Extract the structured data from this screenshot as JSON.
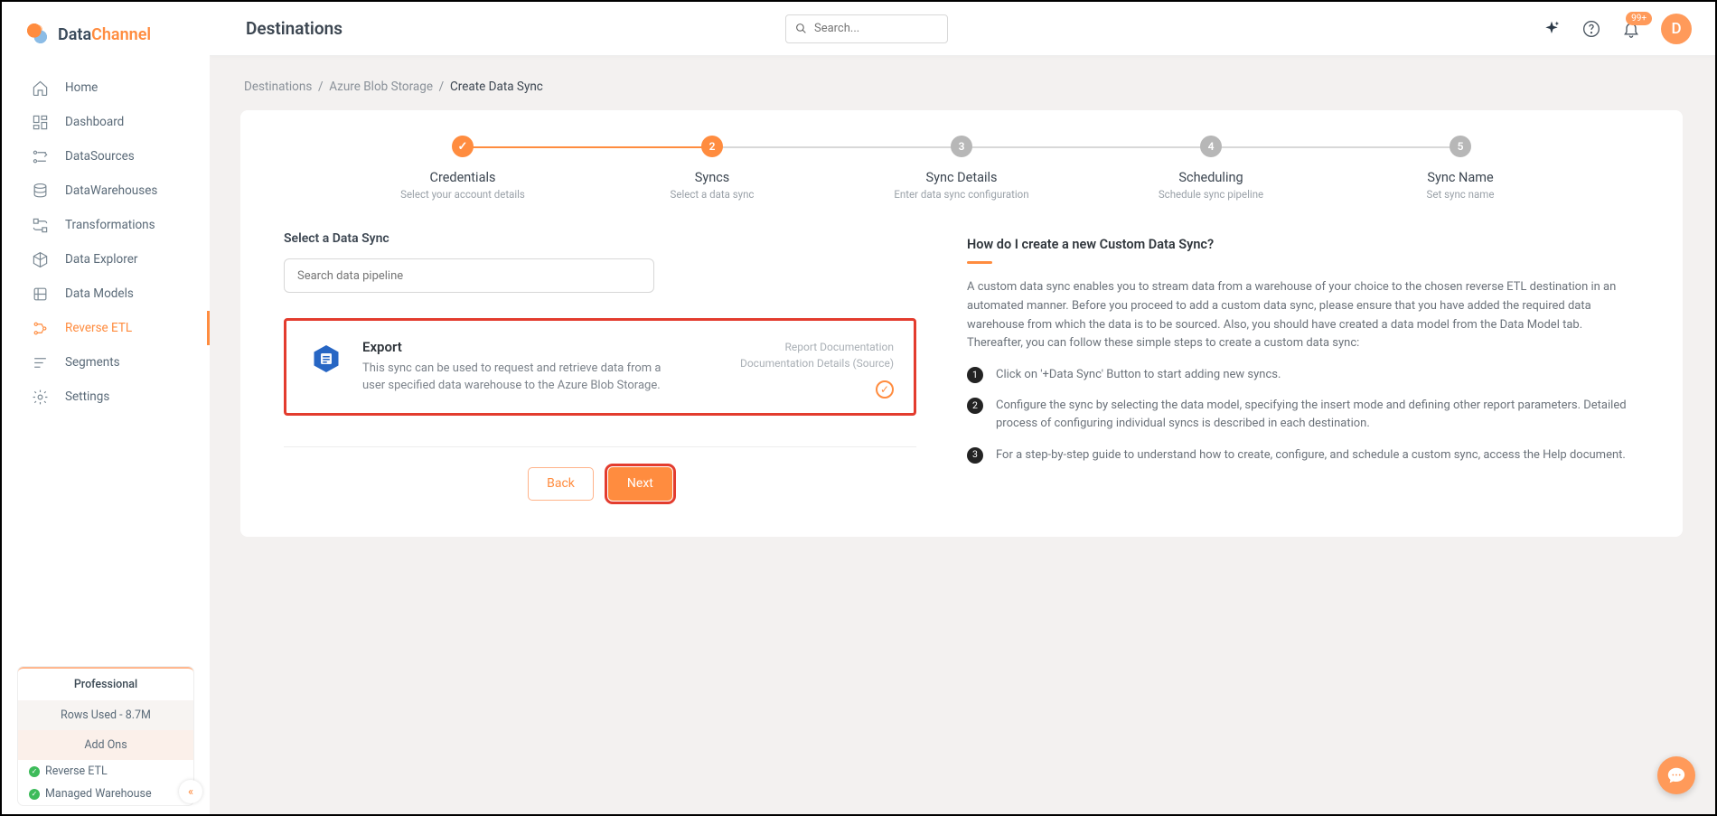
{
  "brand": {
    "name_part1": "Data",
    "name_part2": "Channel"
  },
  "sidebar": {
    "items": [
      {
        "label": "Home"
      },
      {
        "label": "Dashboard"
      },
      {
        "label": "DataSources"
      },
      {
        "label": "DataWarehouses"
      },
      {
        "label": "Transformations"
      },
      {
        "label": "Data Explorer"
      },
      {
        "label": "Data Models"
      },
      {
        "label": "Reverse ETL"
      },
      {
        "label": "Segments"
      },
      {
        "label": "Settings"
      }
    ],
    "plan": {
      "name": "Professional",
      "rows": "Rows Used - 8.7M",
      "addons_title": "Add Ons",
      "addons": [
        "Reverse ETL",
        "Managed Warehouse"
      ]
    }
  },
  "header": {
    "title": "Destinations",
    "search_placeholder": "Search...",
    "notif": "99+",
    "avatar": "D"
  },
  "breadcrumb": {
    "part1": "Destinations",
    "part2": "Azure Blob Storage",
    "part3": "Create Data Sync"
  },
  "steps": [
    {
      "num": "1",
      "title": "Credentials",
      "sub": "Select your account details",
      "state": "done"
    },
    {
      "num": "2",
      "title": "Syncs",
      "sub": "Select a data sync",
      "state": "active"
    },
    {
      "num": "3",
      "title": "Sync Details",
      "sub": "Enter data sync configuration",
      "state": "pending"
    },
    {
      "num": "4",
      "title": "Scheduling",
      "sub": "Schedule sync pipeline",
      "state": "pending"
    },
    {
      "num": "5",
      "title": "Sync Name",
      "sub": "Set sync name",
      "state": "pending"
    }
  ],
  "syncs": {
    "section_label": "Select a Data Sync",
    "search_placeholder": "Search data pipeline",
    "card": {
      "title": "Export",
      "desc": "This sync can be used to request and retrieve data from a user specified data warehouse to the Azure Blob Storage.",
      "meta1": "Report Documentation",
      "meta2": "Documentation Details (Source)"
    }
  },
  "buttons": {
    "back": "Back",
    "next": "Next"
  },
  "help": {
    "title": "How do I create a new Custom Data Sync?",
    "p": "A custom data sync enables you to stream data from a warehouse of your choice to the chosen reverse ETL destination in an automated manner. Before you proceed to add a custom data sync, please ensure that you have added the required data warehouse from which the data is to be sourced. Also, you should have created a data model from the Data Model tab.\nThereafter, you can follow these simple steps to create a custom data sync:",
    "items": [
      "Click on '+Data Sync' Button to start adding new syncs.",
      "Configure the sync by selecting the data model, specifying the insert mode and defining other report parameters. Detailed process of configuring individual syncs is described in each destination.",
      "For a step-by-step guide to understand how to create, configure, and schedule a custom sync, access the Help document."
    ]
  }
}
